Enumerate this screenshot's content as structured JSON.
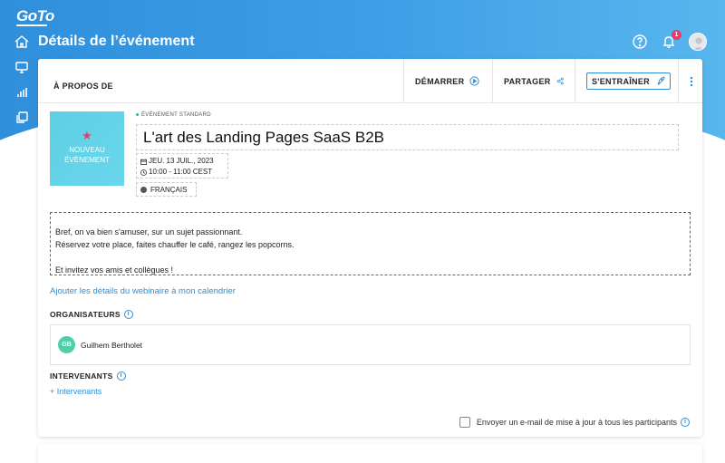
{
  "app": {
    "logo_text": "GoTo",
    "page_title": "Détails de l’événement",
    "notification_count": "1"
  },
  "sidebar": {
    "items": [
      {
        "icon": "home-icon"
      },
      {
        "icon": "monitor-icon"
      },
      {
        "icon": "analytics-icon"
      },
      {
        "icon": "library-icon"
      },
      {
        "icon": "settings-icon"
      }
    ]
  },
  "header": {
    "about_label": "À PROPOS DE",
    "start_label": "DÉMARRER",
    "share_label": "PARTAGER",
    "train_label": "S'ENTRAÎNER"
  },
  "event": {
    "thumb_line1": "NOUVEAU",
    "thumb_line2": "ÉVÉNEMENT",
    "type": "ÉVÉNEMENT STANDARD",
    "title": "L'art des Landing Pages SaaS B2B",
    "date": "JEU. 13 JUIL., 2023",
    "time": "10:00 - 11:00 CEST",
    "language": "FRANÇAIS",
    "description": [
      "Bref, on va bien s'amuser, sur un sujet passionnant.",
      "Réservez votre place, faites chauffer le café, rangez les popcorns.",
      "",
      "Et invitez vos amis et collègues !"
    ],
    "calendar_link": "Ajouter les détails du webinaire à mon calendrier"
  },
  "organizers": {
    "label": "ORGANISATEURS",
    "items": [
      {
        "initials": "GB",
        "name": "Guilhem Bertholet"
      }
    ]
  },
  "speakers": {
    "label": "INTERVENANTS",
    "add_label": "+ Intervenants"
  },
  "notify": {
    "label": "Envoyer un e-mail de mise à jour à tous les participants",
    "checked": false
  },
  "colors": {
    "brand_blue": "#2e8fd8",
    "accent_pink": "#e63d6a",
    "thumb_cyan": "#5ecfe3",
    "avatar_green": "#4fcfa8"
  }
}
